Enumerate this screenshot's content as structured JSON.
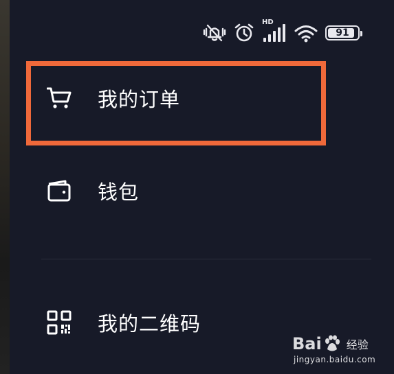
{
  "status_bar": {
    "icons": [
      "vibrate-mute-icon",
      "alarm-icon",
      "signal-icon",
      "wifi-icon",
      "battery-icon"
    ],
    "signal_tag": "HD",
    "battery_percent": 91,
    "battery_label": "91"
  },
  "menu": {
    "items": [
      {
        "label": "我的订单",
        "icon": "cart-icon",
        "highlighted": true
      },
      {
        "label": "钱包",
        "icon": "wallet-icon",
        "highlighted": false
      },
      {
        "label": "我的二维码",
        "icon": "qrcode-icon",
        "highlighted": false
      }
    ]
  },
  "highlight_color": "#f0693a",
  "background_color": "#171a28",
  "watermark": {
    "brand": "Bai",
    "brand_suffix": "经验",
    "url": "jingyan.baidu.com"
  }
}
